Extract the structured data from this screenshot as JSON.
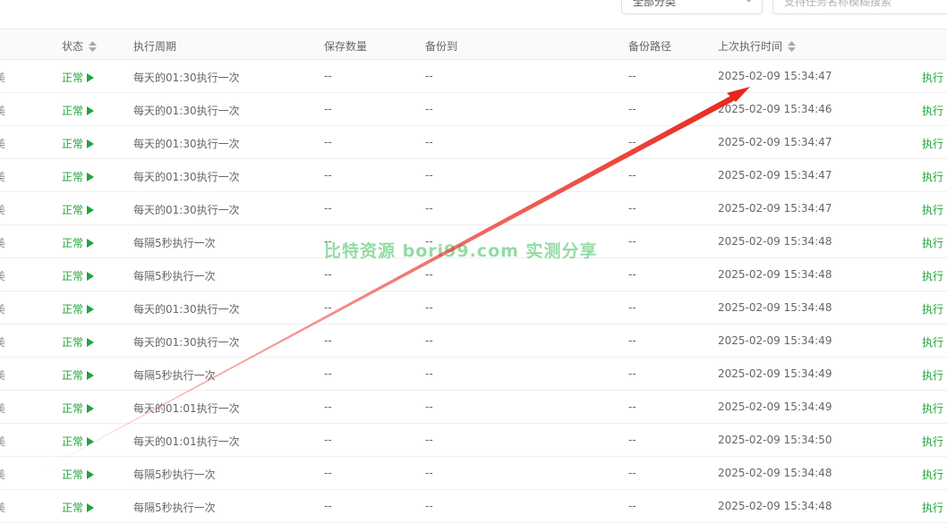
{
  "toolbar": {
    "category_select": "全部分类",
    "search_placeholder": "支持任务名称模糊搜索"
  },
  "table": {
    "headers": {
      "status": "状态",
      "cycle": "执行周期",
      "keep_count": "保存数量",
      "backup_to": "备份到",
      "backup_path": "备份路径",
      "last_run": "上次执行时间"
    },
    "rows": [
      {
        "name_tail": "美",
        "status": "正常",
        "cycle": "每天的01:30执行一次",
        "keep": "--",
        "backup_to": "--",
        "path": "--",
        "last_run": "2025-02-09 15:34:47",
        "action": "执行"
      },
      {
        "name_tail": "美",
        "status": "正常",
        "cycle": "每天的01:30执行一次",
        "keep": "--",
        "backup_to": "--",
        "path": "--",
        "last_run": "2025-02-09 15:34:46",
        "action": "执行"
      },
      {
        "name_tail": "美",
        "status": "正常",
        "cycle": "每天的01:30执行一次",
        "keep": "--",
        "backup_to": "--",
        "path": "--",
        "last_run": "2025-02-09 15:34:47",
        "action": "执行"
      },
      {
        "name_tail": "美",
        "status": "正常",
        "cycle": "每天的01:30执行一次",
        "keep": "--",
        "backup_to": "--",
        "path": "--",
        "last_run": "2025-02-09 15:34:47",
        "action": "执行"
      },
      {
        "name_tail": "美",
        "status": "正常",
        "cycle": "每天的01:30执行一次",
        "keep": "--",
        "backup_to": "--",
        "path": "--",
        "last_run": "2025-02-09 15:34:47",
        "action": "执行"
      },
      {
        "name_tail": "美",
        "status": "正常",
        "cycle": "每隔5秒执行一次",
        "keep": "--",
        "backup_to": "--",
        "path": "--",
        "last_run": "2025-02-09 15:34:48",
        "action": "执行"
      },
      {
        "name_tail": "美",
        "status": "正常",
        "cycle": "每隔5秒执行一次",
        "keep": "--",
        "backup_to": "--",
        "path": "--",
        "last_run": "2025-02-09 15:34:48",
        "action": "执行"
      },
      {
        "name_tail": "美",
        "status": "正常",
        "cycle": "每天的01:30执行一次",
        "keep": "--",
        "backup_to": "--",
        "path": "--",
        "last_run": "2025-02-09 15:34:48",
        "action": "执行"
      },
      {
        "name_tail": "美",
        "status": "正常",
        "cycle": "每天的01:30执行一次",
        "keep": "--",
        "backup_to": "--",
        "path": "--",
        "last_run": "2025-02-09 15:34:49",
        "action": "执行"
      },
      {
        "name_tail": "美",
        "status": "正常",
        "cycle": "每隔5秒执行一次",
        "keep": "--",
        "backup_to": "--",
        "path": "--",
        "last_run": "2025-02-09 15:34:49",
        "action": "执行"
      },
      {
        "name_tail": "美",
        "status": "正常",
        "cycle": "每天的01:01执行一次",
        "keep": "--",
        "backup_to": "--",
        "path": "--",
        "last_run": "2025-02-09 15:34:49",
        "action": "执行"
      },
      {
        "name_tail": "美",
        "status": "正常",
        "cycle": "每天的01:01执行一次",
        "keep": "--",
        "backup_to": "--",
        "path": "--",
        "last_run": "2025-02-09 15:34:50",
        "action": "执行"
      },
      {
        "name_tail": "美",
        "status": "正常",
        "cycle": "每隔5秒执行一次",
        "keep": "--",
        "backup_to": "--",
        "path": "--",
        "last_run": "2025-02-09 15:34:48",
        "action": "执行"
      },
      {
        "name_tail": "美",
        "status": "正常",
        "cycle": "每隔5秒执行一次",
        "keep": "--",
        "backup_to": "--",
        "path": "--",
        "last_run": "2025-02-09 15:34:48",
        "action": "执行"
      }
    ]
  },
  "watermark": "比特资源 bori99.com 实测分享",
  "colors": {
    "accent": "#20a53a",
    "annotation": "#e8261c"
  }
}
